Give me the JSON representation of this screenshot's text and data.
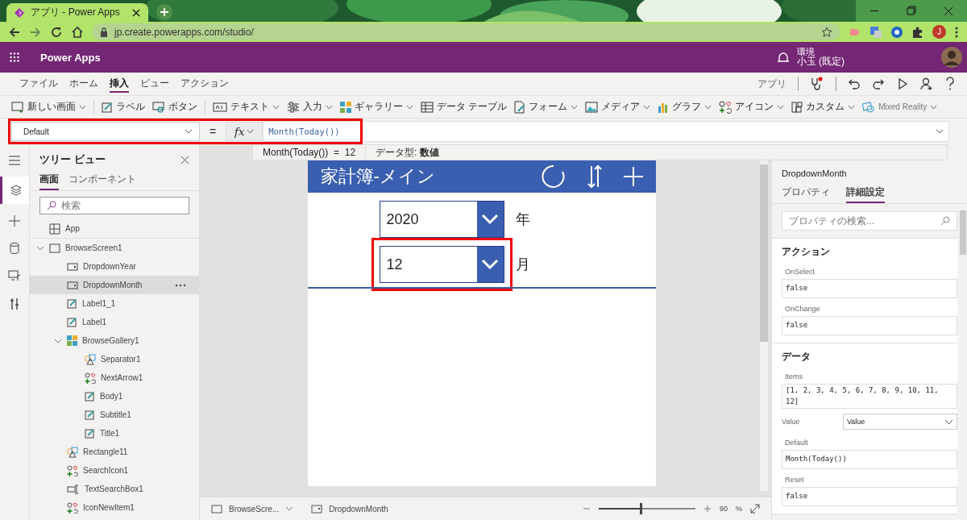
{
  "browser": {
    "tab_title": "アプリ - Power Apps",
    "url": "jp.create.powerapps.com/studio/",
    "profile_initial": "J"
  },
  "app_bar": {
    "title": "Power Apps",
    "environment_label": "環境",
    "environment": "小玉 (既定)"
  },
  "menu_tabs": [
    {
      "label": "ファイル",
      "selected": false
    },
    {
      "label": "ホーム",
      "selected": false
    },
    {
      "label": "挿入",
      "selected": true
    },
    {
      "label": "ビュー",
      "selected": false
    },
    {
      "label": "アクション",
      "selected": false
    }
  ],
  "menu_right": {
    "label": "アプリ"
  },
  "ribbon": [
    {
      "label": "新しい画面",
      "kind": "screen",
      "has_menu": true
    },
    {
      "label": "ラベル",
      "kind": "label",
      "has_menu": false
    },
    {
      "label": "ボタン",
      "kind": "button",
      "has_menu": false
    },
    {
      "label": "テキスト",
      "kind": "text",
      "has_menu": true
    },
    {
      "label": "入力",
      "kind": "input",
      "has_menu": true
    },
    {
      "label": "ギャラリー",
      "kind": "gallery",
      "has_menu": true
    },
    {
      "label": "データ テーブル",
      "kind": "table",
      "has_menu": false
    },
    {
      "label": "フォーム",
      "kind": "form",
      "has_menu": true
    },
    {
      "label": "メディア",
      "kind": "media",
      "has_menu": true
    },
    {
      "label": "グラフ",
      "kind": "chart",
      "has_menu": true
    },
    {
      "label": "アイコン",
      "kind": "icons",
      "has_menu": true
    },
    {
      "label": "カスタム",
      "kind": "custom",
      "has_menu": true
    },
    {
      "label": "Mixed Reality",
      "kind": "mixed",
      "has_menu": true
    }
  ],
  "formula_bar": {
    "property": "Default",
    "equals": "=",
    "fx": "fx",
    "formula": "Month(Today())",
    "result": "Month(Today())  =  12",
    "data_type": "データ型: **数値**"
  },
  "tree_view": {
    "title": "ツリー ビュー",
    "tabs": [
      {
        "label": "画面",
        "selected": true
      },
      {
        "label": "コンポーネント",
        "selected": false
      }
    ],
    "search": {
      "placeholder": "検索"
    },
    "items": [
      {
        "label": "App",
        "kind": "app",
        "selected": false
      },
      {
        "label": "BrowseScreen1",
        "kind": "screen",
        "selected": false,
        "expanded": true,
        "children": [
          {
            "label": "DropdownYear",
            "kind": "dropdown",
            "selected": false
          },
          {
            "label": "DropdownMonth",
            "kind": "dropdown",
            "selected": true
          },
          {
            "label": "Label1_1",
            "kind": "label",
            "selected": false
          },
          {
            "label": "Label1",
            "kind": "label",
            "selected": false
          },
          {
            "label": "BrowseGallery1",
            "kind": "gallery",
            "selected": false,
            "expanded": true,
            "children": [
              {
                "label": "Separator1",
                "kind": "shape",
                "selected": false
              },
              {
                "label": "NextArrow1",
                "kind": "icon",
                "selected": false
              },
              {
                "label": "Body1",
                "kind": "label",
                "selected": false
              },
              {
                "label": "Subtitle1",
                "kind": "label",
                "selected": false
              },
              {
                "label": "Title1",
                "kind": "label",
                "selected": false
              }
            ]
          },
          {
            "label": "Rectangle11",
            "kind": "shape",
            "selected": false
          },
          {
            "label": "SearchIcon1",
            "kind": "icon",
            "selected": false
          },
          {
            "label": "TextSearchBox1",
            "kind": "textinput",
            "selected": false
          },
          {
            "label": "IconNewItem1",
            "kind": "icon",
            "selected": false
          }
        ]
      }
    ]
  },
  "canvas": {
    "screen_title": "家計簿-メイン",
    "dropdowns": [
      {
        "value": "2020",
        "suffix": "年",
        "highlighted": false
      },
      {
        "value": "12",
        "suffix": "月",
        "highlighted": true
      }
    ]
  },
  "bottom_bar": {
    "screen": "BrowseScre...",
    "control": "DropdownMonth",
    "zoom": {
      "level": 0.45,
      "value": "90",
      "unit": "%"
    }
  },
  "properties": {
    "control": "DropdownMonth",
    "tabs": [
      {
        "label": "プロパティ",
        "selected": false
      },
      {
        "label": "詳細設定",
        "selected": true
      }
    ],
    "search": {
      "placeholder": "プロパティの検索..."
    },
    "sections": [
      {
        "title": "アクション",
        "fields": [
          {
            "label": "OnSelect",
            "value": "false",
            "kind": "formula"
          },
          {
            "label": "OnChange",
            "value": "false",
            "kind": "formula"
          }
        ]
      },
      {
        "title": "データ",
        "fields": [
          {
            "label": "Items",
            "value": "[1, 2, 3, 4, 5, 6, 7, 8, 9, 10, 11, 12]",
            "kind": "formula"
          },
          {
            "label": "Value",
            "value": "Value",
            "kind": "select"
          },
          {
            "label": "Default",
            "value": "Month(Today())",
            "kind": "formula"
          },
          {
            "label": "Reset",
            "value": "false",
            "kind": "formula"
          }
        ]
      }
    ]
  }
}
